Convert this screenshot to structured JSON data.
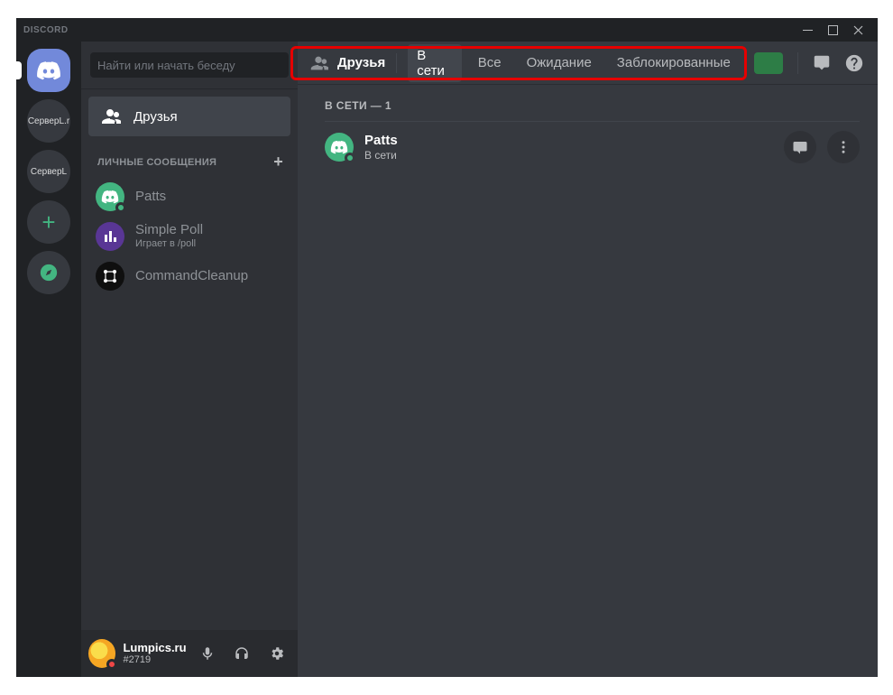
{
  "window": {
    "brand": "DISCORD"
  },
  "servers": {
    "s1": "СерверL.r",
    "s2": "СерверL"
  },
  "search": {
    "placeholder": "Найти или начать беседу"
  },
  "nav": {
    "friends_label": "Друзья"
  },
  "dm": {
    "header": "ЛИЧНЫЕ СООБЩЕНИЯ",
    "items": [
      {
        "name": "Patts",
        "sub": ""
      },
      {
        "name": "Simple Poll",
        "sub": "Играет в /poll"
      },
      {
        "name": "CommandCleanup",
        "sub": ""
      }
    ]
  },
  "user": {
    "name": "Lumpics.ru",
    "tag": "#2719"
  },
  "topbar": {
    "friends_label": "Друзья",
    "tabs": {
      "online": "В сети",
      "all": "Все",
      "pending": "Ожидание",
      "blocked": "Заблокированные"
    }
  },
  "friends": {
    "section_title": "В СЕТИ — 1",
    "list": [
      {
        "name": "Patts",
        "status": "В сети"
      }
    ]
  }
}
